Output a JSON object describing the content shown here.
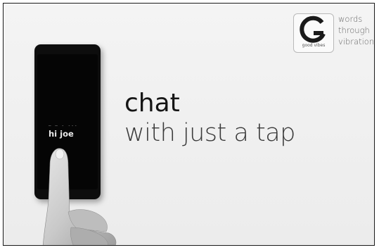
{
  "logo": {
    "icon": "g-logo-icon",
    "subtitle": "good vibes",
    "tagline": [
      "words",
      "through",
      "vibrations"
    ]
  },
  "headline": {
    "line1": "chat",
    "line2": "with just a tap"
  },
  "phone": {
    "dots": "— — - ---",
    "message": "hi joe"
  },
  "colors": {
    "background": "#efefef",
    "text_dark": "#151515",
    "text_light": "#3a3a3a",
    "phone": "#0d0d0d"
  }
}
